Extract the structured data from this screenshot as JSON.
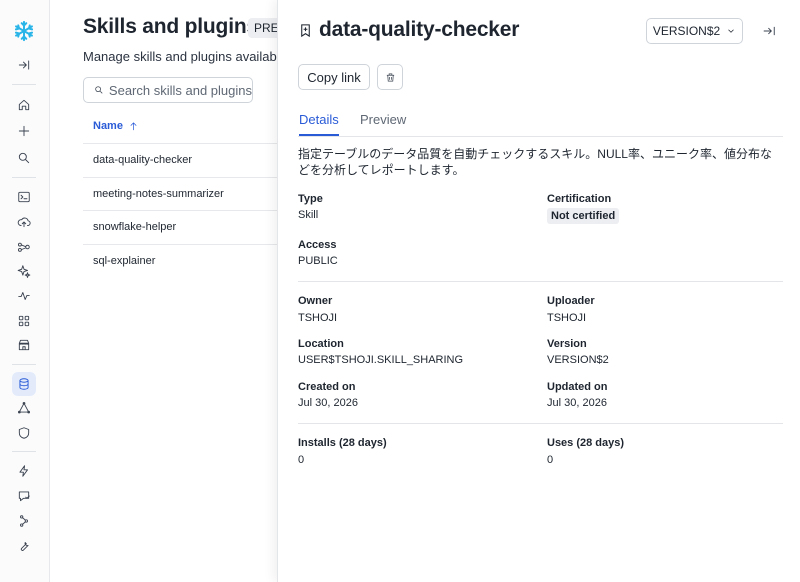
{
  "rail": {
    "items": [
      {
        "icon": "snowflake-logo-icon"
      },
      {
        "icon": "expand-sidebar-icon"
      },
      {
        "icon": "home-icon"
      },
      {
        "icon": "plus-icon"
      },
      {
        "icon": "search-icon"
      },
      {
        "icon": "terminal-icon"
      },
      {
        "icon": "cloud-upload-icon"
      },
      {
        "icon": "graph-icon"
      },
      {
        "icon": "sparkle-icon"
      },
      {
        "icon": "activity-icon"
      },
      {
        "icon": "grid-icon"
      },
      {
        "icon": "marketplace-icon"
      },
      {
        "icon": "database-icon",
        "active": true
      },
      {
        "icon": "triangle-nodes-icon"
      },
      {
        "icon": "shield-icon"
      },
      {
        "icon": "lightning-icon"
      },
      {
        "icon": "chat-bubble-icon"
      },
      {
        "icon": "connections-icon"
      },
      {
        "icon": "wrench-icon"
      }
    ]
  },
  "list_page": {
    "title": "Skills and plugins",
    "badge": "PREV",
    "subtitle": "Manage skills and plugins available",
    "search_placeholder": "Search skills and plugins",
    "column_name": "Name",
    "rows": [
      "data-quality-checker",
      "meeting-notes-summarizer",
      "snowflake-helper",
      "sql-explainer"
    ]
  },
  "panel": {
    "title": "data-quality-checker",
    "version_button": "VERSION$2",
    "copy_link": "Copy link",
    "tabs": [
      "Details",
      "Preview"
    ],
    "active_tab": "Details",
    "description": "指定テーブルのデータ品質を自動チェックするスキル。NULL率、ユニーク率、値分布などを分析してレポートします。",
    "fields": {
      "type_label": "Type",
      "type_value": "Skill",
      "certification_label": "Certification",
      "certification_value": "Not certified",
      "access_label": "Access",
      "access_value": "PUBLIC",
      "owner_label": "Owner",
      "owner_value": "TSHOJI",
      "uploader_label": "Uploader",
      "uploader_value": "TSHOJI",
      "location_label": "Location",
      "location_value": "USER$TSHOJI.SKILL_SHARING",
      "version_label": "Version",
      "version_value": "VERSION$2",
      "created_label": "Created on",
      "created_value": "Jul 30, 2026",
      "updated_label": "Updated on",
      "updated_value": "Jul 30, 2026",
      "installs_label": "Installs (28 days)",
      "installs_value": "0",
      "uses_label": "Uses (28 days)",
      "uses_value": "0"
    }
  },
  "colors": {
    "accent": "#2a5bd7",
    "logo": "#29b5e8"
  }
}
